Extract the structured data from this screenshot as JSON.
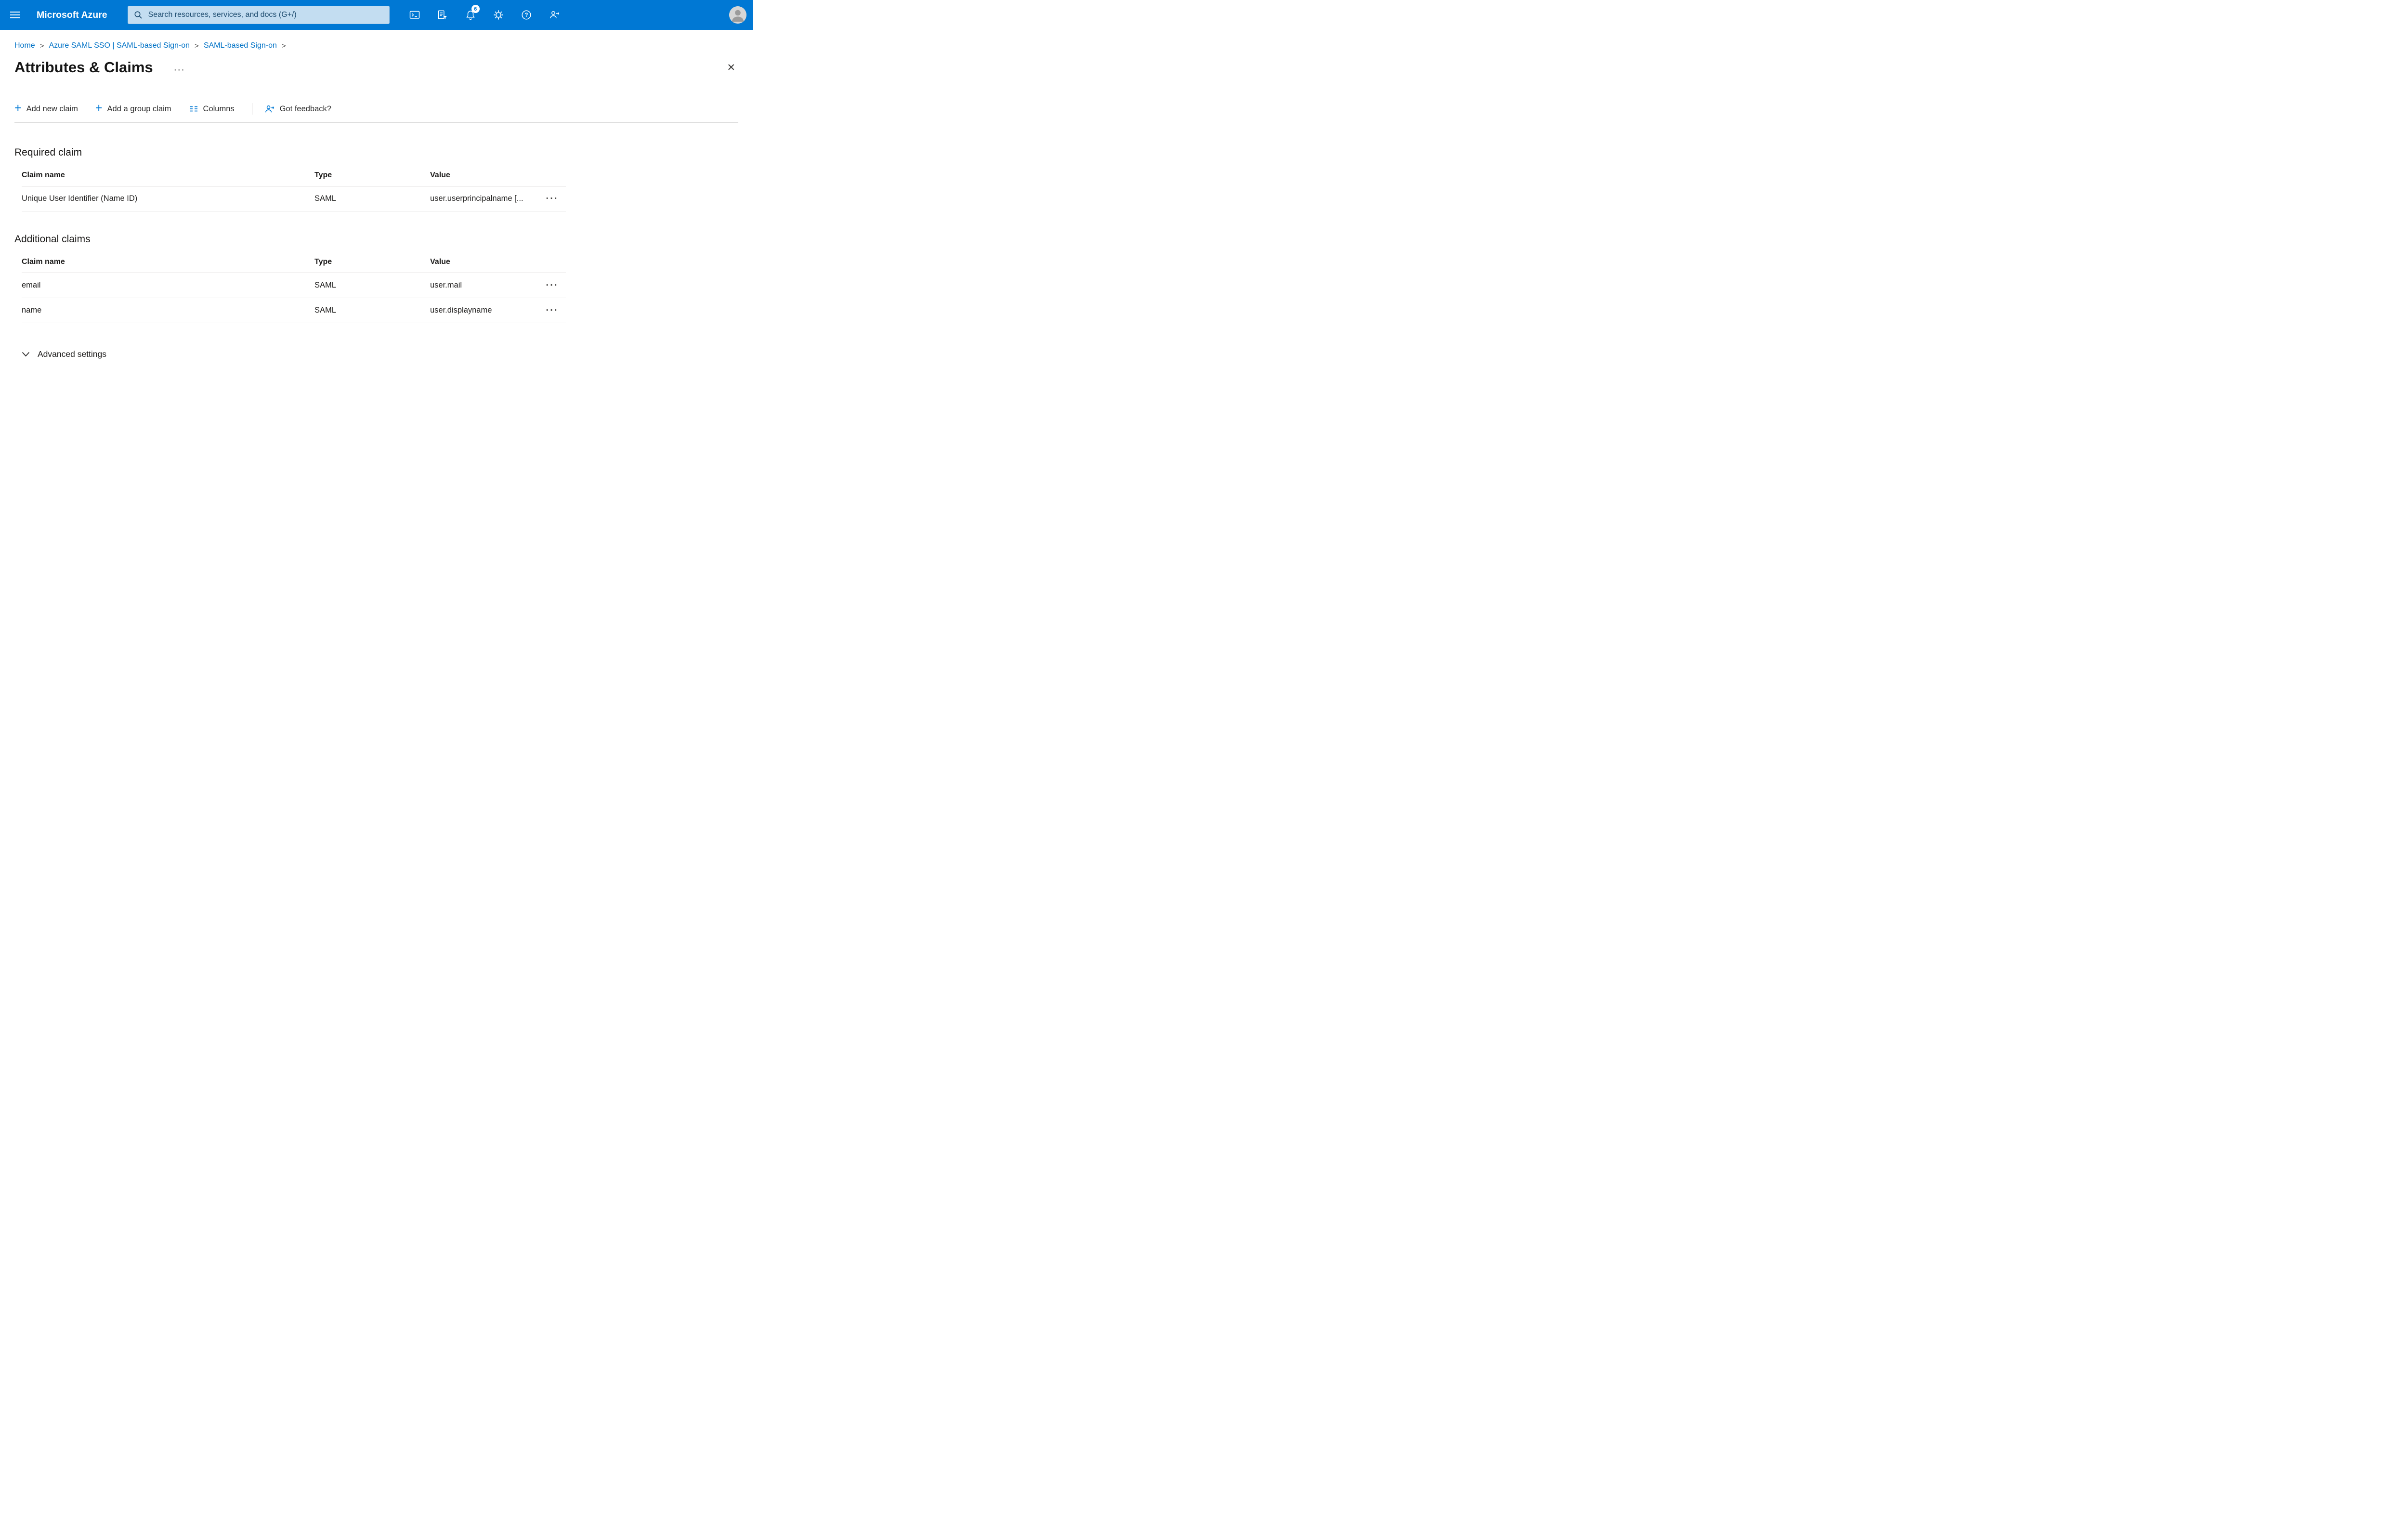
{
  "topbar": {
    "brand": "Microsoft Azure",
    "search": {
      "placeholder": "Search resources, services, and docs (G+/)"
    },
    "notifications_badge": "6",
    "icon_names": [
      "hamburger-menu-icon",
      "search-icon",
      "cloud-shell-icon",
      "directory-filter-icon",
      "notifications-bell-icon",
      "settings-gear-icon",
      "help-icon",
      "feedback-icon",
      "avatar"
    ]
  },
  "breadcrumb": {
    "separator": ">",
    "items": [
      "Home",
      "Azure SAML SSO | SAML-based Sign-on",
      "SAML-based Sign-on"
    ]
  },
  "page": {
    "title": "Attributes & Claims",
    "more_icon": "···",
    "close_icon": "✕"
  },
  "toolbar": {
    "add_new_claim": "Add new claim",
    "add_group_claim": "Add a group claim",
    "columns_label": "Columns",
    "feedback_label": "Got feedback?"
  },
  "icons": {
    "plus": "+"
  },
  "ui": {
    "row_menu_icon": "···"
  },
  "required_claim": {
    "heading": "Required claim",
    "columns": [
      "Claim name",
      "Type",
      "Value"
    ],
    "rows": [
      {
        "claim_name": "Unique User Identifier (Name ID)",
        "type": "SAML",
        "value": "user.userprincipalname [..."
      }
    ]
  },
  "additional_claims": {
    "heading": "Additional claims",
    "columns": [
      "Claim name",
      "Type",
      "Value"
    ],
    "rows": [
      {
        "claim_name": "email",
        "type": "SAML",
        "value": "user.mail"
      },
      {
        "claim_name": "name",
        "type": "SAML",
        "value": "user.displayname"
      }
    ]
  },
  "advanced_settings": {
    "label": "Advanced settings"
  },
  "colors": {
    "topbar": "#0078d4",
    "accent": "#0078d4",
    "link": "#0072c6",
    "search_background": "#c3ddf1"
  }
}
